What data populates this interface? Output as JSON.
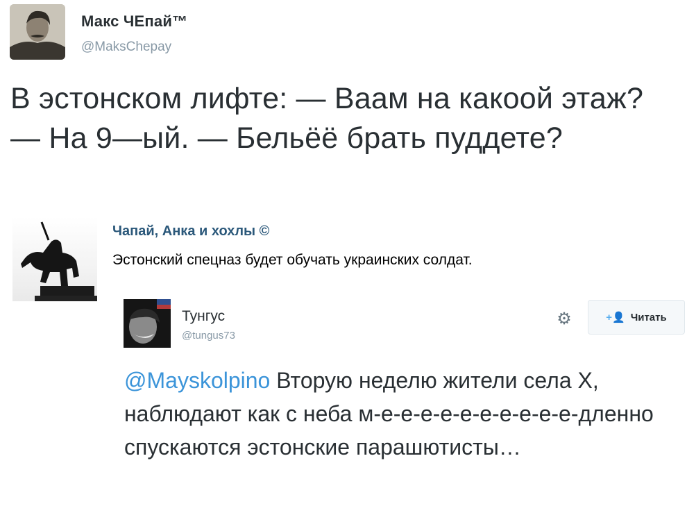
{
  "tweet": {
    "author_name": "Макс ЧЕпай™",
    "author_handle": "@MaksChepay",
    "text": "В эстонском лифте: — Ваам на какоой этаж? — На 9—ый. — Бельёё брать пуддете?"
  },
  "vk_post": {
    "group_name": "Чапай, Анка и хохлы ©",
    "text": "Эстонский спецназ будет обучать украинских солдат."
  },
  "embedded_tweet": {
    "author_name": "Тунгус",
    "author_handle": "@tungus73",
    "follow_label": "Читать",
    "mention": "@Mayskolpino",
    "text": " Вторую неделю жители села Х, наблюдают как с неба м-е-е-е-е-е-е-е-е-е-е-дленно спускаются эстонские парашютисты…"
  },
  "colors": {
    "link": "#3b94d9",
    "vk_name": "#2b587a",
    "handle": "#8899a6"
  },
  "icons": [
    "gear-icon",
    "follow-icon"
  ]
}
